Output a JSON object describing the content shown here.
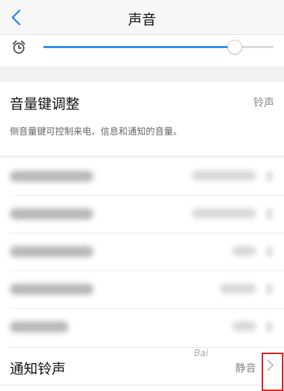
{
  "header": {
    "title": "声音"
  },
  "alarm": {
    "icon": "alarm-clock-icon",
    "volume_fraction": 0.83
  },
  "volume_keys": {
    "title": "音量键调整",
    "value": "铃声",
    "description": "侧音量键可控制来电、信息和通知的音量。"
  },
  "notification": {
    "label": "通知铃声",
    "value": "静音"
  },
  "watermark": {
    "text": "Bai"
  },
  "colors": {
    "accent": "#2f8cf0",
    "highlight_box": "#e51616"
  }
}
